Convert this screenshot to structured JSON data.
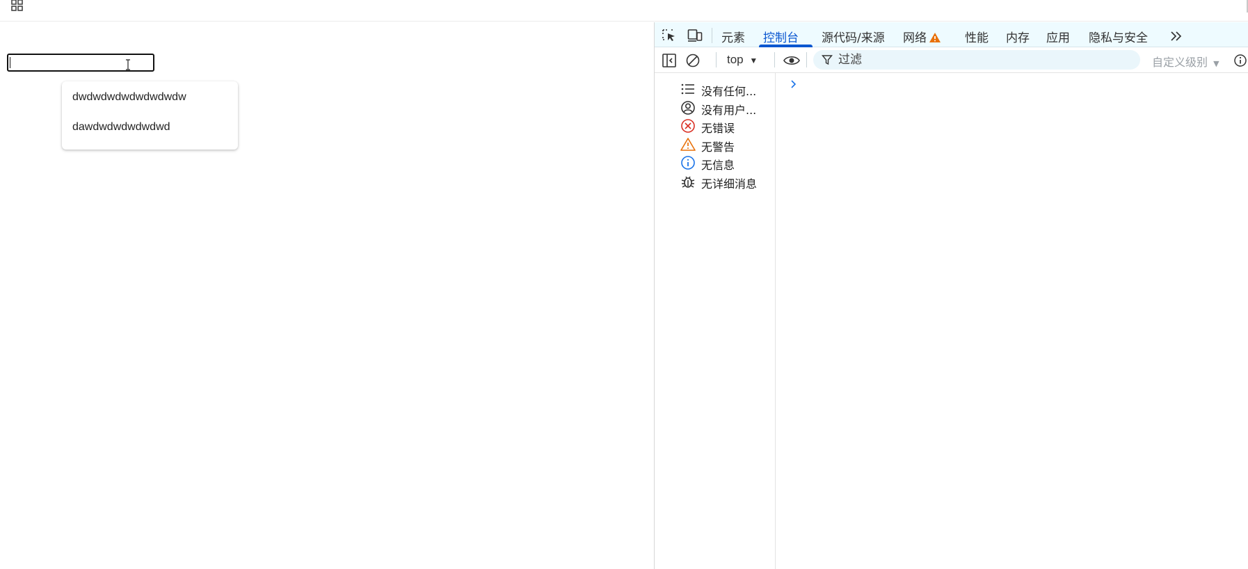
{
  "page": {
    "suggestions": [
      {
        "text": "dwdwdwdwdwdwdwdw"
      },
      {
        "text": "dawdwdwdwdwdwd"
      }
    ],
    "input": {
      "value": ""
    }
  },
  "devtools": {
    "tabs": [
      {
        "label": "元素"
      },
      {
        "label": "控制台",
        "active": true
      },
      {
        "label": "源代码/来源"
      },
      {
        "label": "网络"
      },
      {
        "label": "性能"
      },
      {
        "label": "内存"
      },
      {
        "label": "应用"
      },
      {
        "label": "隐私与安全"
      }
    ],
    "more_tabs_icon": "chevrons-right-icon",
    "toolbar": {
      "context": "top",
      "filter_placeholder": "过滤",
      "level": "自定义级别"
    },
    "sidebar": [
      {
        "label": "没有任何...",
        "icon": "list-icon"
      },
      {
        "label": "没有用户...",
        "icon": "user-icon"
      },
      {
        "label": "无错误",
        "icon": "error-icon"
      },
      {
        "label": "无警告",
        "icon": "warning-icon"
      },
      {
        "label": "无信息",
        "icon": "info-icon"
      },
      {
        "label": "无详细消息",
        "icon": "bug-icon"
      }
    ],
    "colors": {
      "accent": "#0b57d0",
      "error": "#d93025",
      "warning": "#e8710a",
      "info": "#1a73e8"
    }
  }
}
